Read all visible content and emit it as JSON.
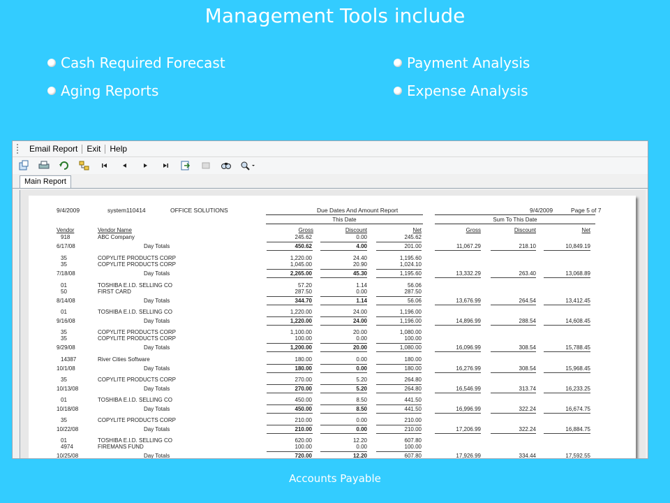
{
  "slide": {
    "title": "Management Tools include",
    "bullets_left": [
      "Cash Required Forecast",
      "Aging Reports"
    ],
    "bullets_right": [
      "Payment Analysis",
      "Expense Analysis"
    ],
    "footer": "Accounts Payable"
  },
  "window": {
    "menu": [
      "Email Report",
      "Exit",
      "Help"
    ],
    "toolbar_icons": [
      "export-icon",
      "print-icon",
      "refresh-icon",
      "tree-toggle-icon",
      "first-page-icon",
      "prev-page-icon",
      "next-page-icon",
      "last-page-icon",
      "goto-page-icon",
      "stop-icon",
      "search-icon",
      "zoom-icon"
    ],
    "tab": "Main Report"
  },
  "report": {
    "date": "9/4/2009",
    "user": "system110414",
    "company": "OFFICE SOLUTIONS",
    "title": "Due Dates And Amount Report",
    "print_date": "9/4/2009",
    "page": "Page 5 of 7",
    "group_this_date": "This Date",
    "group_sum": "Sum To This Date",
    "col_vendor": "Vendor",
    "col_vendor_name": "Vendor Name",
    "col_gross": "Gross",
    "col_discount": "Discount",
    "col_net": "Net",
    "col_sum_gross": "Gross",
    "col_sum_discount": "Discount",
    "col_sum_net": "Net",
    "rows": [
      {
        "type": "detail",
        "vendor": "918",
        "name": "ABC Company",
        "gross": "245.62",
        "discount": "0.00",
        "net": "245.62"
      },
      {
        "type": "total",
        "date": "6/17/08",
        "label": "Day Totals",
        "gross": "450.62",
        "discount": "4.00",
        "net": "201.00",
        "sgross": "11,067.29",
        "sdisc": "218.10",
        "snet": "10,849.19"
      },
      {
        "type": "detail",
        "vendor": "35",
        "name": "COPYLITE PRODUCTS CORP",
        "gross": "1,220.00",
        "discount": "24.40",
        "net": "1,195.60"
      },
      {
        "type": "detail",
        "vendor": "35",
        "name": "COPYLITE PRODUCTS CORP",
        "gross": "1,045.00",
        "discount": "20.90",
        "net": "1,024.10"
      },
      {
        "type": "total",
        "date": "7/18/08",
        "label": "Day Totals",
        "gross": "2,265.00",
        "discount": "45.30",
        "net": "1,195.60",
        "sgross": "13,332.29",
        "sdisc": "263.40",
        "snet": "13,068.89"
      },
      {
        "type": "detail",
        "vendor": "01",
        "name": "TOSHIBA E.I.D. SELLING CO",
        "gross": "57.20",
        "discount": "1.14",
        "net": "56.06"
      },
      {
        "type": "detail",
        "vendor": "50",
        "name": "FIRST CARD",
        "gross": "287.50",
        "discount": "0.00",
        "net": "287.50"
      },
      {
        "type": "total",
        "date": "8/14/08",
        "label": "Day Totals",
        "gross": "344.70",
        "discount": "1.14",
        "net": "56.06",
        "sgross": "13,676.99",
        "sdisc": "264.54",
        "snet": "13,412.45"
      },
      {
        "type": "detail",
        "vendor": "01",
        "name": "TOSHIBA E.I.D. SELLING CO",
        "gross": "1,220.00",
        "discount": "24.00",
        "net": "1,196.00"
      },
      {
        "type": "total",
        "date": "9/16/08",
        "label": "Day Totals",
        "gross": "1,220.00",
        "discount": "24.00",
        "net": "1,196.00",
        "sgross": "14,896.99",
        "sdisc": "288.54",
        "snet": "14,608.45"
      },
      {
        "type": "detail",
        "vendor": "35",
        "name": "COPYLITE PRODUCTS CORP",
        "gross": "1,100.00",
        "discount": "20.00",
        "net": "1,080.00"
      },
      {
        "type": "detail",
        "vendor": "35",
        "name": "COPYLITE PRODUCTS CORP",
        "gross": "100.00",
        "discount": "0.00",
        "net": "100.00"
      },
      {
        "type": "total",
        "date": "9/29/08",
        "label": "Day Totals",
        "gross": "1,200.00",
        "discount": "20.00",
        "net": "1,080.00",
        "sgross": "16,096.99",
        "sdisc": "308.54",
        "snet": "15,788.45"
      },
      {
        "type": "detail",
        "vendor": "14387",
        "name": "River Cities Software",
        "gross": "180.00",
        "discount": "0.00",
        "net": "180.00"
      },
      {
        "type": "total",
        "date": "10/1/08",
        "label": "Day Totals",
        "gross": "180.00",
        "discount": "0.00",
        "net": "180.00",
        "sgross": "16,276.99",
        "sdisc": "308.54",
        "snet": "15,968.45"
      },
      {
        "type": "detail",
        "vendor": "35",
        "name": "COPYLITE PRODUCTS CORP",
        "gross": "270.00",
        "discount": "5.20",
        "net": "264.80"
      },
      {
        "type": "total",
        "date": "10/13/08",
        "label": "Day Totals",
        "gross": "270.00",
        "discount": "5.20",
        "net": "264.80",
        "sgross": "16,546.99",
        "sdisc": "313.74",
        "snet": "16,233.25"
      },
      {
        "type": "detail",
        "vendor": "01",
        "name": "TOSHIBA E.I.D. SELLING CO",
        "gross": "450.00",
        "discount": "8.50",
        "net": "441.50"
      },
      {
        "type": "total",
        "date": "10/18/08",
        "label": "Day Totals",
        "gross": "450.00",
        "discount": "8.50",
        "net": "441.50",
        "sgross": "16,996.99",
        "sdisc": "322.24",
        "snet": "16,674.75"
      },
      {
        "type": "detail",
        "vendor": "35",
        "name": "COPYLITE PRODUCTS CORP",
        "gross": "210.00",
        "discount": "0.00",
        "net": "210.00"
      },
      {
        "type": "total",
        "date": "10/22/08",
        "label": "Day Totals",
        "gross": "210.00",
        "discount": "0.00",
        "net": "210.00",
        "sgross": "17,206.99",
        "sdisc": "322.24",
        "snet": "16,884.75"
      },
      {
        "type": "detail",
        "vendor": "01",
        "name": "TOSHIBA E.I.D. SELLING CO",
        "gross": "620.00",
        "discount": "12.20",
        "net": "607.80"
      },
      {
        "type": "detail",
        "vendor": "4974",
        "name": "FIREMANS FUND",
        "gross": "100.00",
        "discount": "0.00",
        "net": "100.00"
      },
      {
        "type": "total",
        "date": "10/25/08",
        "label": "Day Totals",
        "gross": "720.00",
        "discount": "12.20",
        "net": "607.80",
        "sgross": "17,926.99",
        "sdisc": "334.44",
        "snet": "17,592.55"
      }
    ]
  }
}
